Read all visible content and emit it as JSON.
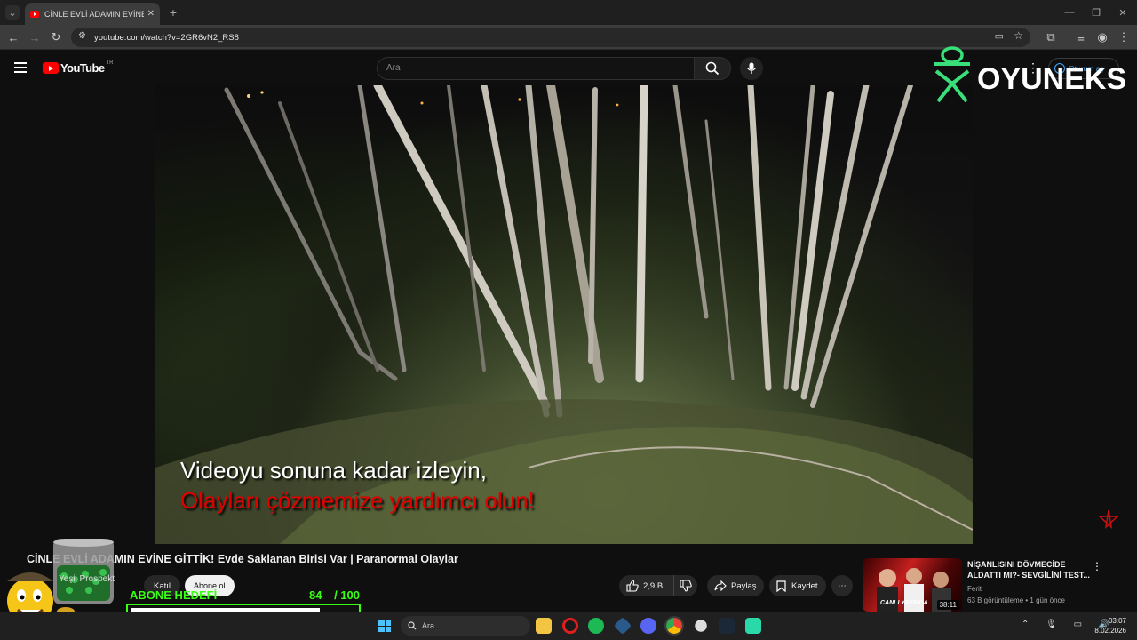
{
  "browser": {
    "tab_title": "CİNLE EVLİ ADAMIN EVİNE GİTTİ",
    "tab_close": "✕",
    "new_tab": "+",
    "url": "youtube.com/watch?v=2GR6vN2_RS8"
  },
  "youtube": {
    "logo_text": "YouTube",
    "country_code": "TR",
    "search_placeholder": "Ara",
    "sign_in": "Oturum aç"
  },
  "video": {
    "subtitle_line1": "Videoyu sonuna kadar izleyin,",
    "subtitle_line2": "Olayları çözmemize yardımcı olun!",
    "title": "CİNLE EVLİ ADAMIN EVİNE GİTTİK! Evde Saklanan Birisi Var | Paranormal Olaylar",
    "channel": "Yeşil Prospekt",
    "join_label": "Katıl",
    "subscribe_label": "Abone ol",
    "likes": "2,9 B",
    "share_label": "Paylaş",
    "save_label": "Kaydet",
    "more_label": "⋯"
  },
  "overlay": {
    "brand": "OYUNEKS",
    "goal_label": "ABONE HEDEFİ",
    "goal_current": "84",
    "goal_total": "/ 100",
    "goal_fraction": 0.84
  },
  "related": {
    "title": "NİŞANLISINI DÖVMECİDE ALDATTI MI?- SEVGİLİNİ TEST...",
    "channel": "Ferit",
    "meta": "63 B görüntüleme • 1 gün önce",
    "duration": "38:11",
    "thumb_text": "CANLI YAYINDA"
  },
  "taskbar": {
    "search_placeholder": "Ara",
    "time": "03:07",
    "date": "8.02.2026"
  },
  "colors": {
    "accent_green": "#39ff14",
    "youtube_red": "#ff0000",
    "link_blue": "#3ea6ff"
  }
}
